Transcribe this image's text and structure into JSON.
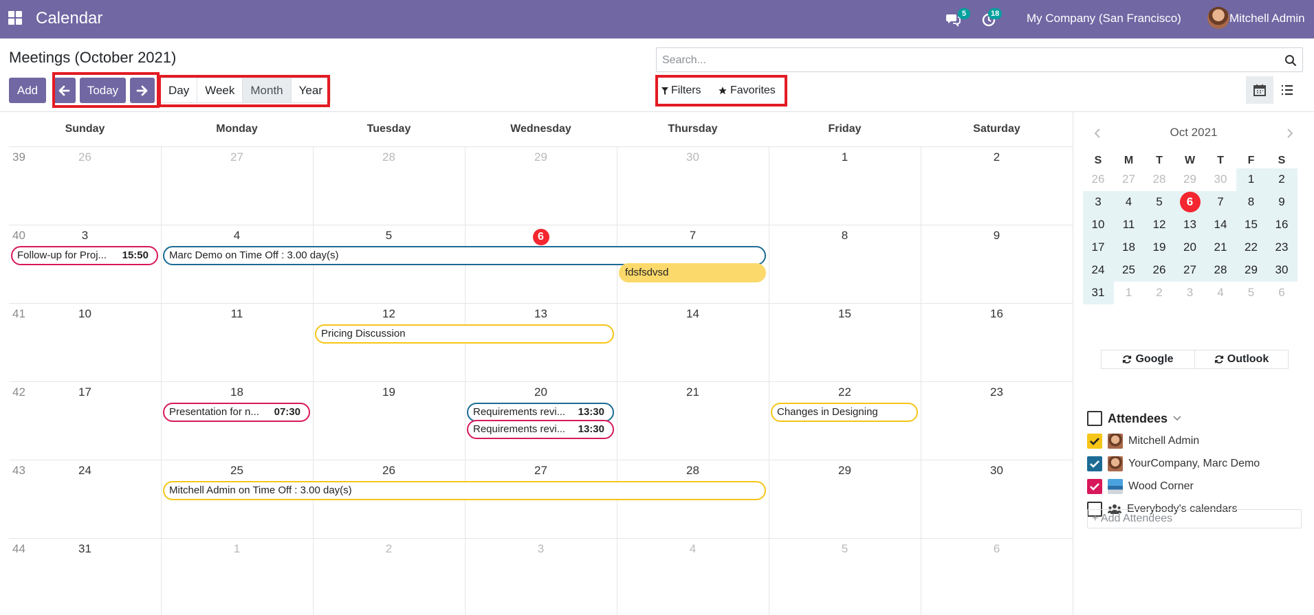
{
  "navbar": {
    "app_title": "Calendar",
    "messages_count": "5",
    "activities_count": "18",
    "company": "My Company (San Francisco)",
    "user": "Mitchell Admin",
    "brand_color": "#7167a3"
  },
  "control_panel": {
    "title": "Meetings (October 2021)",
    "add_label": "Add",
    "today_label": "Today",
    "ranges": [
      "Day",
      "Week",
      "Month",
      "Year"
    ],
    "active_range": "Month",
    "search_placeholder": "Search...",
    "filters_label": "Filters",
    "favorites_label": "Favorites",
    "views": [
      "calendar",
      "list"
    ]
  },
  "calendar": {
    "weekdays": [
      "Sunday",
      "Monday",
      "Tuesday",
      "Wednesday",
      "Thursday",
      "Friday",
      "Saturday"
    ],
    "weeks": [
      {
        "num": "39",
        "days": [
          "26",
          "27",
          "28",
          "29",
          "30",
          "1",
          "2"
        ],
        "other": [
          true,
          true,
          true,
          true,
          true,
          false,
          false
        ]
      },
      {
        "num": "40",
        "days": [
          "3",
          "4",
          "5",
          "6",
          "7",
          "8",
          "9"
        ],
        "other": [
          false,
          false,
          false,
          false,
          false,
          false,
          false
        ]
      },
      {
        "num": "41",
        "days": [
          "10",
          "11",
          "12",
          "13",
          "14",
          "15",
          "16"
        ],
        "other": [
          false,
          false,
          false,
          false,
          false,
          false,
          false
        ]
      },
      {
        "num": "42",
        "days": [
          "17",
          "18",
          "19",
          "20",
          "21",
          "22",
          "23"
        ],
        "other": [
          false,
          false,
          false,
          false,
          false,
          false,
          false
        ]
      },
      {
        "num": "43",
        "days": [
          "24",
          "25",
          "26",
          "27",
          "28",
          "29",
          "30"
        ],
        "other": [
          false,
          false,
          false,
          false,
          false,
          false,
          false
        ]
      },
      {
        "num": "44",
        "days": [
          "31",
          "1",
          "2",
          "3",
          "4",
          "5",
          "6"
        ],
        "other": [
          false,
          true,
          true,
          true,
          true,
          true,
          true
        ]
      }
    ],
    "today": "6",
    "events": [
      {
        "title": "Follow-up for Proj...",
        "time": "15:50",
        "color": "red",
        "week": 1,
        "start": 0,
        "span": 1,
        "row": 0
      },
      {
        "title": "Marc Demo on Time Off : 3.00 day(s)",
        "time": "",
        "color": "blue",
        "week": 1,
        "start": 1,
        "span": 4,
        "row": 0
      },
      {
        "title": "fdsfsdvsd",
        "time": "",
        "color": "filled",
        "week": 1,
        "start": 4,
        "span": 1,
        "row": 1
      },
      {
        "title": "Pricing Discussion",
        "time": "",
        "color": "yellow",
        "week": 2,
        "start": 2,
        "span": 2,
        "row": 0
      },
      {
        "title": "Presentation for n...",
        "time": "07:30",
        "color": "red",
        "week": 3,
        "start": 1,
        "span": 1,
        "row": 0
      },
      {
        "title": "Requirements revi...",
        "time": "13:30",
        "color": "blue",
        "week": 3,
        "start": 3,
        "span": 1,
        "row": 0
      },
      {
        "title": "Requirements revi...",
        "time": "13:30",
        "color": "red",
        "week": 3,
        "start": 3,
        "span": 1,
        "row": 1
      },
      {
        "title": "Changes in Designing",
        "time": "",
        "color": "yellow",
        "week": 3,
        "start": 5,
        "span": 1,
        "row": 0
      },
      {
        "title": "Mitchell Admin on Time Off : 3.00 day(s)",
        "time": "",
        "color": "yellow",
        "week": 4,
        "start": 1,
        "span": 4,
        "row": 0
      }
    ]
  },
  "mini_calendar": {
    "title": "Oct 2021",
    "weekdays": [
      "S",
      "M",
      "T",
      "W",
      "T",
      "F",
      "S"
    ],
    "weeks": [
      [
        "26",
        "27",
        "28",
        "29",
        "30",
        "1",
        "2"
      ],
      [
        "3",
        "4",
        "5",
        "6",
        "7",
        "8",
        "9"
      ],
      [
        "10",
        "11",
        "12",
        "13",
        "14",
        "15",
        "16"
      ],
      [
        "17",
        "18",
        "19",
        "20",
        "21",
        "22",
        "23"
      ],
      [
        "24",
        "25",
        "26",
        "27",
        "28",
        "29",
        "30"
      ],
      [
        "31",
        "1",
        "2",
        "3",
        "4",
        "5",
        "6"
      ]
    ]
  },
  "sync": {
    "google": "Google",
    "outlook": "Outlook"
  },
  "attendees": {
    "title": "Attendees",
    "items": [
      {
        "name": "Mitchell Admin",
        "color": "#f5c518",
        "checked": true,
        "icon": "avatar"
      },
      {
        "name": "YourCompany, Marc Demo",
        "color": "#1b6b94",
        "checked": true,
        "icon": "avatar"
      },
      {
        "name": "Wood Corner",
        "color": "#d8185a",
        "checked": true,
        "icon": "company-logo"
      },
      {
        "name": "Everybody's calendars",
        "color": "",
        "checked": false,
        "icon": "users-icon"
      }
    ],
    "add_placeholder": "+ Add Attendees"
  }
}
